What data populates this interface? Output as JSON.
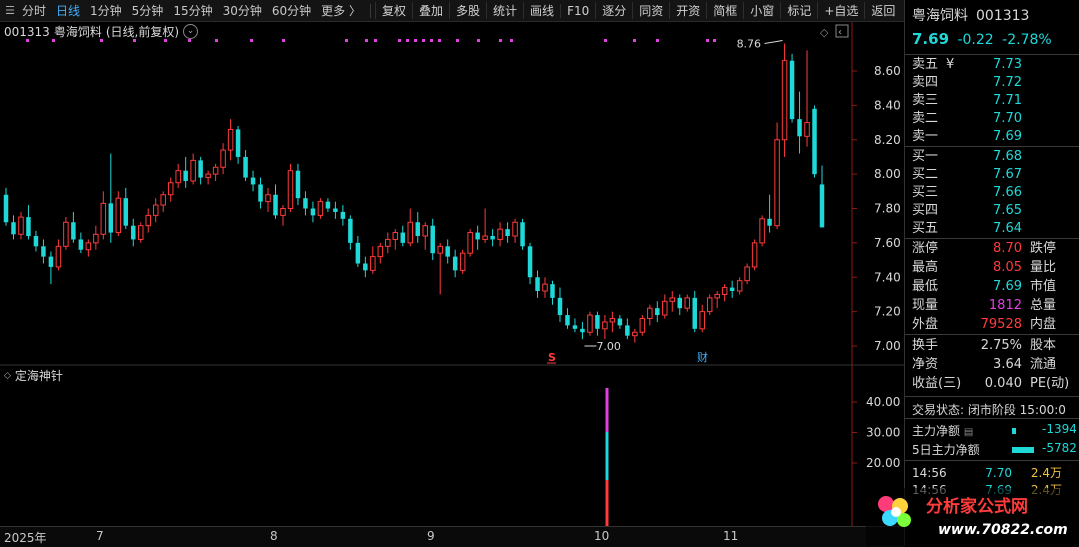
{
  "toolbar": {
    "periods": [
      "分时",
      "日线",
      "1分钟",
      "5分钟",
      "15分钟",
      "30分钟",
      "60分钟",
      "更多 〉"
    ],
    "active_period": "日线",
    "buttons": [
      "复权",
      "叠加",
      "多股",
      "统计",
      "画线",
      "F10",
      "逐分",
      "同资",
      "开资",
      "简框",
      "小窗",
      "标记",
      "+自选",
      "返回"
    ]
  },
  "chart": {
    "header_code": "001313",
    "header_name": "粤海饲料",
    "header_mode": "(日线,前复权)",
    "y_ticks": [
      "8.60",
      "8.40",
      "8.20",
      "8.00",
      "7.80",
      "7.60",
      "7.40",
      "7.20",
      "7.00"
    ],
    "y_values": [
      8.6,
      8.4,
      8.2,
      8.0,
      7.8,
      7.6,
      7.4,
      7.2,
      7.0
    ],
    "high_label": "8.76",
    "low_label": "7.00",
    "mark_s": "S",
    "mark_cai": "财"
  },
  "indicator": {
    "name": "定海神针",
    "y_ticks": [
      "40.00",
      "30.00",
      "20.00"
    ]
  },
  "xaxis": {
    "labels": [
      "2025年",
      "7",
      "8",
      "9",
      "10",
      "11"
    ]
  },
  "colors": {
    "up": "#ff3b3b",
    "down": "#1fd8d8",
    "accent": "#3fb0ff",
    "purple": "#e040e0"
  },
  "panel": {
    "name": "粤海饲料",
    "code": "001313",
    "price": "7.69",
    "change": "-0.22",
    "pct": "-2.78%",
    "asks": [
      {
        "label": "卖五",
        "mark": "¥",
        "price": "7.73"
      },
      {
        "label": "卖四",
        "mark": "",
        "price": "7.72"
      },
      {
        "label": "卖三",
        "mark": "",
        "price": "7.71"
      },
      {
        "label": "卖二",
        "mark": "",
        "price": "7.70"
      },
      {
        "label": "卖一",
        "mark": "",
        "price": "7.69"
      }
    ],
    "bids": [
      {
        "label": "买一",
        "price": "7.68"
      },
      {
        "label": "买二",
        "price": "7.67"
      },
      {
        "label": "买三",
        "price": "7.66"
      },
      {
        "label": "买四",
        "price": "7.65"
      },
      {
        "label": "买五",
        "price": "7.64"
      }
    ],
    "stats1": [
      {
        "l1": "涨停",
        "v1": "8.70",
        "c1": "red",
        "l2": "跌停"
      },
      {
        "l1": "最高",
        "v1": "8.05",
        "c1": "red",
        "l2": "量比"
      },
      {
        "l1": "最低",
        "v1": "7.69",
        "c1": "down",
        "l2": "市值"
      },
      {
        "l1": "现量",
        "v1": "1812",
        "c1": "purple",
        "l2": "总量"
      },
      {
        "l1": "外盘",
        "v1": "79528",
        "c1": "red",
        "l2": "内盘"
      }
    ],
    "stats2": [
      {
        "l1": "换手",
        "v1": "2.75%",
        "c1": "white",
        "l2": "股本"
      },
      {
        "l1": "净资",
        "v1": "3.64",
        "c1": "white",
        "l2": "流通"
      },
      {
        "l1": "收益(三)",
        "v1": "0.040",
        "c1": "white",
        "l2": "PE(动)"
      }
    ],
    "trade_state": "交易状态: 闭市阶段 15:00:0",
    "flow": [
      {
        "label": "主力净额",
        "value": "-1394"
      },
      {
        "label": "5日主力净额",
        "value": "-5782"
      }
    ],
    "ticks": [
      {
        "time": "14:56",
        "price": "7.70",
        "vol": "2.4万"
      },
      {
        "time": "14:56",
        "price": "7.69",
        "vol": "2.4万"
      }
    ]
  },
  "watermark": {
    "text": "分析家公式网",
    "url": "www.70822.com"
  }
}
